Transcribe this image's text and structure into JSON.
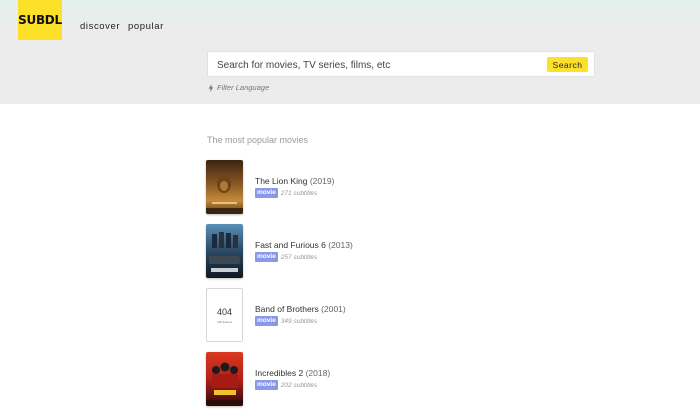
{
  "header": {
    "logo_text": "SUBDL",
    "nav": [
      {
        "label": "discover"
      },
      {
        "label": "popular"
      }
    ]
  },
  "search": {
    "placeholder": "Search for movies, TV series, films, etc",
    "button_label": "Search",
    "filter_label": "Filter Language",
    "filter_icon": "bolt-icon"
  },
  "section": {
    "title": "The most popular movies"
  },
  "movies": [
    {
      "title": "The Lion King",
      "year": "(2019)",
      "type": "movie",
      "subtitles": "271 subtitles",
      "poster_icon": "lion-king-poster"
    },
    {
      "title": "Fast and Furious 6",
      "year": "(2013)",
      "type": "movie",
      "subtitles": "257 subtitles",
      "poster_icon": "fast-furious-poster"
    },
    {
      "title": "Band of Brothers",
      "year": "(2001)",
      "type": "movie",
      "subtitles": "349 subtitles",
      "poster_code": "404",
      "poster_text": "Not Found"
    },
    {
      "title": "Incredibles 2",
      "year": "(2018)",
      "type": "movie",
      "subtitles": "202 subtitles",
      "poster_icon": "incredibles-poster"
    }
  ],
  "colors": {
    "brand_yellow": "#fde02a",
    "badge_blue": "#8c98e6",
    "header_bg": "#ececec"
  }
}
